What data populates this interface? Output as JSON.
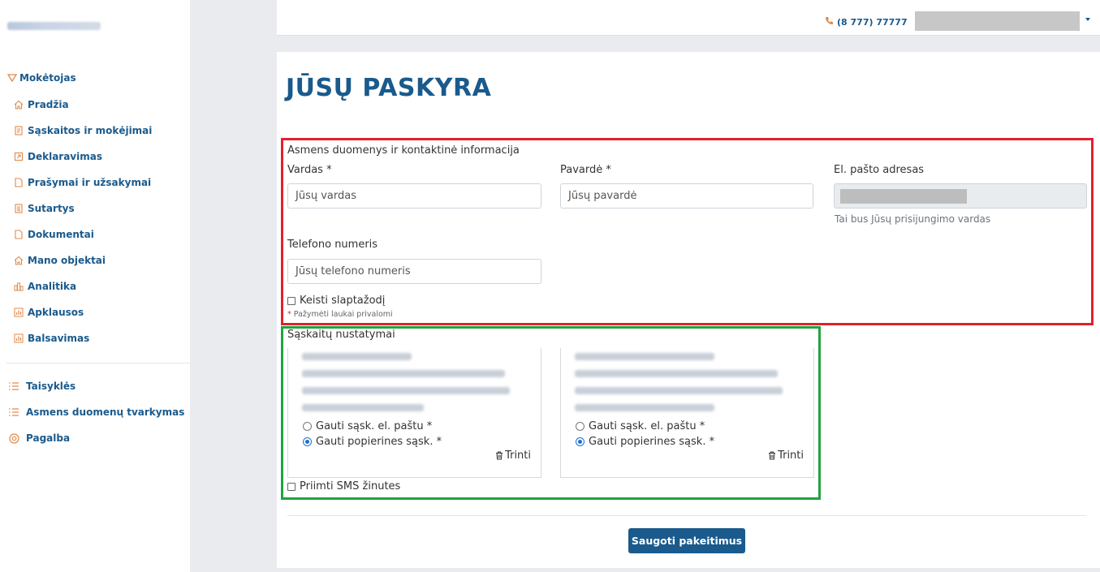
{
  "sidebar": {
    "header": "Mokėtojas",
    "items": [
      {
        "label": "Pradžia",
        "icon": "home-icon"
      },
      {
        "label": "Sąskaitos ir mokėjimai",
        "icon": "invoice-icon"
      },
      {
        "label": "Deklaravimas",
        "icon": "declaration-icon"
      },
      {
        "label": "Prašymai ir užsakymai",
        "icon": "document-icon"
      },
      {
        "label": "Sutartys",
        "icon": "contract-icon"
      },
      {
        "label": "Dokumentai",
        "icon": "document-icon"
      },
      {
        "label": "Mano objektai",
        "icon": "home-icon"
      },
      {
        "label": "Analitika",
        "icon": "chart-icon"
      },
      {
        "label": "Apklausos",
        "icon": "chart-icon"
      },
      {
        "label": "Balsavimas",
        "icon": "chart-icon"
      }
    ],
    "secondary": [
      {
        "label": "Taisyklės",
        "icon": "list-icon"
      },
      {
        "label": "Asmens duomenų tvarkymas",
        "icon": "list-icon"
      },
      {
        "label": "Pagalba",
        "icon": "lifebuoy-icon"
      }
    ]
  },
  "topbar": {
    "phone": "(8 777) 77777"
  },
  "page": {
    "title": "JŪSŲ PASKYRA"
  },
  "personal": {
    "section_title": "Asmens duomenys ir kontaktinė informacija",
    "first_name_label": "Vardas *",
    "first_name_placeholder": "Jūsų vardas",
    "last_name_label": "Pavardė *",
    "last_name_placeholder": "Jūsų pavardė",
    "email_label": "El. pašto adresas",
    "email_hint": "Tai bus Jūsų prisijungimo vardas",
    "phone_label": "Telefono numeris",
    "phone_placeholder": "Jūsų telefono numeris",
    "change_password_label": "Keisti slaptažodį",
    "required_note": "Pažymėti laukai privalomi",
    "required_mark": "*"
  },
  "billing": {
    "section_title": "Sąskaitų nustatymai",
    "accounts": [
      {
        "email_option": "Gauti sąsk. el. paštu *",
        "paper_option": "Gauti popierines sąsk. *",
        "selected": "paper",
        "delete_label": "Trinti"
      },
      {
        "email_option": "Gauti sąsk. el. paštu *",
        "paper_option": "Gauti popierines sąsk. *",
        "selected": "paper",
        "delete_label": "Trinti"
      }
    ],
    "sms_label": "Priimti SMS žinutes"
  },
  "actions": {
    "save_label": "Saugoti pakeitimus"
  },
  "colors": {
    "primary": "#1a5a8c",
    "accent_icon": "#e08a4a",
    "red_outline": "#e0212f",
    "green_outline": "#22a340"
  }
}
